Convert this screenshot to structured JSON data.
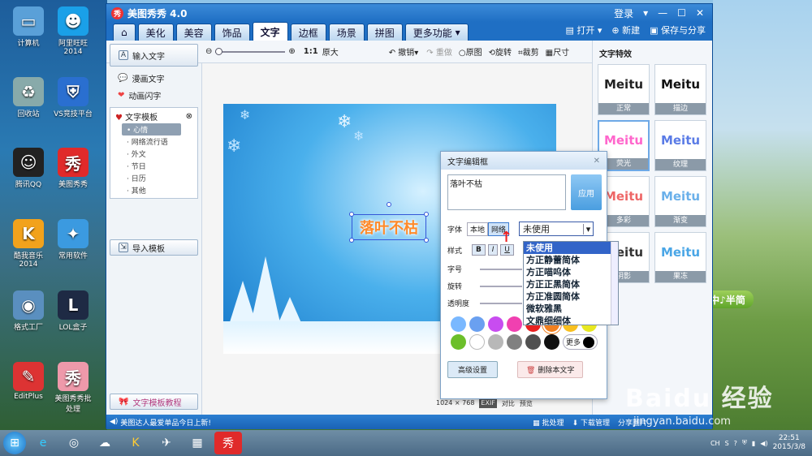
{
  "desktop": {
    "icons": [
      {
        "label": "计算机",
        "glyph": "▭",
        "color": "#5aa0d8"
      },
      {
        "label": "阿里旺旺\n2014",
        "glyph": "☻",
        "color": "#1aa0e8"
      },
      {
        "label": "回收站",
        "glyph": "♻",
        "color": "#8aa"
      },
      {
        "label": "VS竞技平台",
        "glyph": "⛨",
        "color": "#2a6fd0"
      },
      {
        "label": "腾讯QQ",
        "glyph": "☺",
        "color": "#222"
      },
      {
        "label": "美图秀秀",
        "glyph": "秀",
        "color": "#e02a2a"
      },
      {
        "label": "酷我音乐\n2014",
        "glyph": "K",
        "color": "#f2a21c"
      },
      {
        "label": "常用软件",
        "glyph": "✦",
        "color": "#3b9ae0"
      },
      {
        "label": "格式工厂",
        "glyph": "◉",
        "color": "#5a8fbf"
      },
      {
        "label": "LOL盒子",
        "glyph": "L",
        "color": "#1e2a44"
      },
      {
        "label": "EditPlus",
        "glyph": "✎",
        "color": "#d33"
      },
      {
        "label": "美图秀秀批\n处理",
        "glyph": "秀",
        "color": "#e9a"
      }
    ]
  },
  "app": {
    "title": "美图秀秀 4.0",
    "logo": "秀",
    "login": "登录",
    "tabs": [
      "美化",
      "美容",
      "饰品",
      "文字",
      "边框",
      "场景",
      "拼图",
      "更多功能"
    ],
    "active_tab": "文字",
    "top_actions": {
      "open": "打开",
      "new": "新建",
      "save": "保存与分享"
    },
    "toolbar": {
      "zoom_1to1": "1:1",
      "original_size": "原大",
      "undo": "撤销",
      "redo": "重做",
      "original": "原图",
      "rotate": "旋转",
      "crop": "裁剪",
      "size": "尺寸"
    },
    "left": {
      "input_text": "输入文字",
      "comic_text": "漫画文字",
      "anim_text": "动画闪字",
      "template_header": "文字模板",
      "template_items": [
        "心情",
        "网络流行语",
        "外文",
        "节日",
        "日历",
        "其他"
      ],
      "selected_template": "心情",
      "import_template": "导入模板",
      "tutorial": "文字模板教程"
    },
    "canvas": {
      "text": "落叶不枯",
      "dims": "1024 × 768",
      "exif": "EXIF",
      "compare": "对比",
      "preview": "预览"
    },
    "effects": {
      "title": "文字特效",
      "items": [
        {
          "preview": "Meitu",
          "label": "正常",
          "color": "#222"
        },
        {
          "preview": "Meitu",
          "label": "描边",
          "color": "#111"
        },
        {
          "preview": "Meitu",
          "label": "荧光",
          "color": "#f6c"
        },
        {
          "preview": "Meitu",
          "label": "纹理",
          "color": "#5a7be6"
        },
        {
          "preview": "Meitu",
          "label": "多彩",
          "color": "#e66"
        },
        {
          "preview": "Meitu",
          "label": "渐变",
          "color": "#6ab0ea"
        },
        {
          "preview": "Meitu",
          "label": "阴影",
          "color": "#333"
        },
        {
          "preview": "Meitu",
          "label": "果冻",
          "color": "#4aa6e6"
        }
      ]
    },
    "status": {
      "tip": "美图达人最爱单品今日上新!",
      "batch": "批处理",
      "download": "下载管理",
      "share": "分享图片"
    }
  },
  "dialog": {
    "title": "文字编辑框",
    "text_value": "落叶不枯",
    "apply": "应用",
    "font_label": "字体",
    "font_local": "本地",
    "font_web": "网络",
    "font_select": "未使用",
    "style_label": "样式",
    "bold": "B",
    "italic": "I",
    "underline": "U",
    "size_label": "字号",
    "rotate_label": "旋转",
    "opacity_label": "透明度",
    "colors": [
      "#7ab8ff",
      "#6aa0f0",
      "#c84cf0",
      "#f040b0",
      "#e82020",
      "#f08020",
      "#f8c020",
      "#e8e820",
      "#6cbf2a",
      "#ffffff",
      "#b8b8b8",
      "#808080",
      "#505050",
      "#101010"
    ],
    "more": "更多",
    "advanced": "高级设置",
    "delete": "删除本文字",
    "dropdown_options": [
      "未使用",
      "方正静蕾简体",
      "方正喵呜体",
      "方正正黑简体",
      "方正准圆简体",
      "微软雅黑",
      "文鼎细细体"
    ]
  },
  "overlay": {
    "ime": "中♪半简",
    "watermark": "Baidu 经验",
    "watermark_url": "jingyan.baidu.com"
  },
  "taskbar": {
    "time": "22:51",
    "date": "2015/3/8",
    "lang": "CH"
  }
}
